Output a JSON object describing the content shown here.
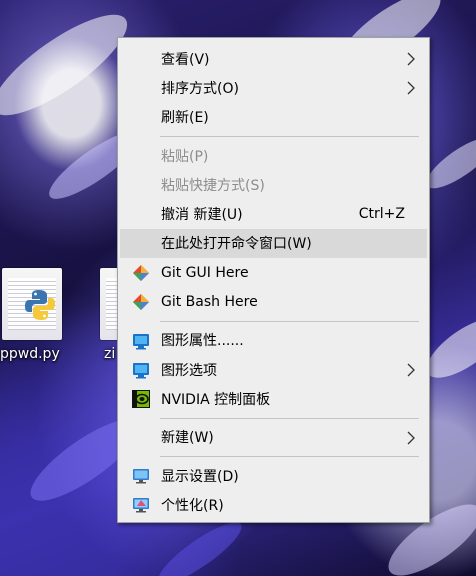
{
  "desktop": {
    "icons": [
      {
        "label": "ppwd.py",
        "icon": "python-file-icon"
      },
      {
        "label": "zi",
        "icon": "file-icon"
      }
    ]
  },
  "context_menu": {
    "items": [
      {
        "label": "查看(V)",
        "submenu": true
      },
      {
        "label": "排序方式(O)",
        "submenu": true
      },
      {
        "label": "刷新(E)"
      },
      {
        "label": "粘贴(P)",
        "disabled": true
      },
      {
        "label": "粘贴快捷方式(S)",
        "disabled": true
      },
      {
        "label": "撤消 新建(U)",
        "shortcut": "Ctrl+Z"
      },
      {
        "label": "在此处打开命令窗口(W)",
        "highlighted": true
      },
      {
        "label": "Git GUI Here",
        "icon": "git-diamond-icon"
      },
      {
        "label": "Git Bash Here",
        "icon": "git-diamond-icon"
      },
      {
        "label": "图形属性......",
        "icon": "intel-graphics-icon"
      },
      {
        "label": "图形选项",
        "icon": "intel-graphics-icon",
        "submenu": true
      },
      {
        "label": "NVIDIA 控制面板",
        "icon": "nvidia-icon"
      },
      {
        "label": "新建(W)",
        "submenu": true
      },
      {
        "label": "显示设置(D)",
        "icon": "display-settings-icon"
      },
      {
        "label": "个性化(R)",
        "icon": "personalize-icon"
      }
    ]
  },
  "colors": {
    "menu_bg": "#eeeeee",
    "hover_bg": "#d9d9d9",
    "disabled_text": "#8d8d8d"
  }
}
